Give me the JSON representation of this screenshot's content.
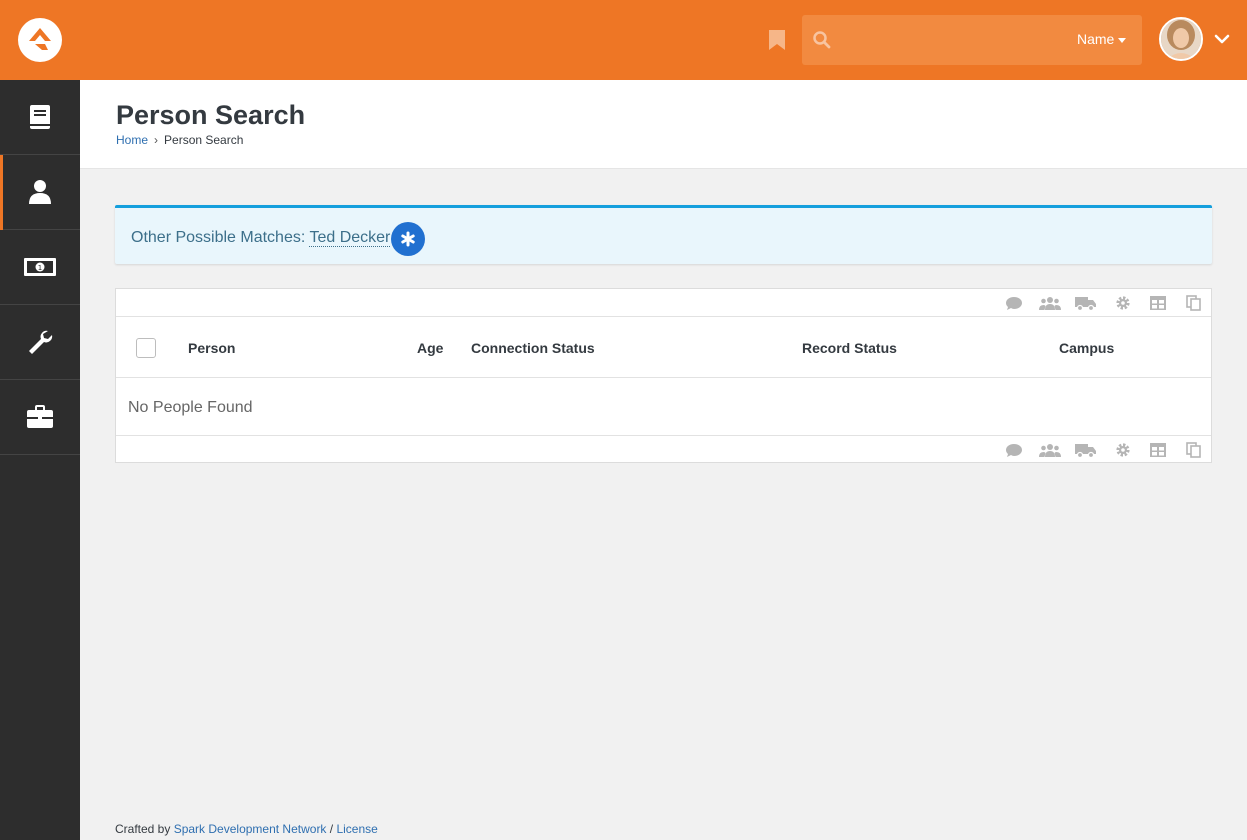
{
  "header": {
    "search": {
      "placeholder": "",
      "type_label": "Name"
    },
    "colors": {
      "brand": "#ee7625",
      "sidebar": "#2d2d2d"
    }
  },
  "sidebar": {
    "items": [
      {
        "icon": "book-icon"
      },
      {
        "icon": "person-icon",
        "active": true
      },
      {
        "icon": "money-icon"
      },
      {
        "icon": "wrench-icon"
      },
      {
        "icon": "briefcase-icon"
      }
    ]
  },
  "page": {
    "title": "Person Search",
    "breadcrumb": {
      "home": "Home",
      "current": "Person Search"
    }
  },
  "alert": {
    "label": "Other Possible Matches:",
    "match_name": "Ted Decker"
  },
  "grid": {
    "columns": [
      "Person",
      "Age",
      "Connection Status",
      "Record Status",
      "Campus"
    ],
    "empty_text": "No People Found",
    "action_icons": [
      "communicate-icon",
      "merge-person-icon",
      "bulk-update-icon",
      "launch-workflow-icon",
      "export-excel-icon",
      "merge-template-icon"
    ]
  },
  "footer": {
    "crafted_by": "Crafted by",
    "org": "Spark Development Network",
    "separator": "/",
    "license": "License"
  }
}
